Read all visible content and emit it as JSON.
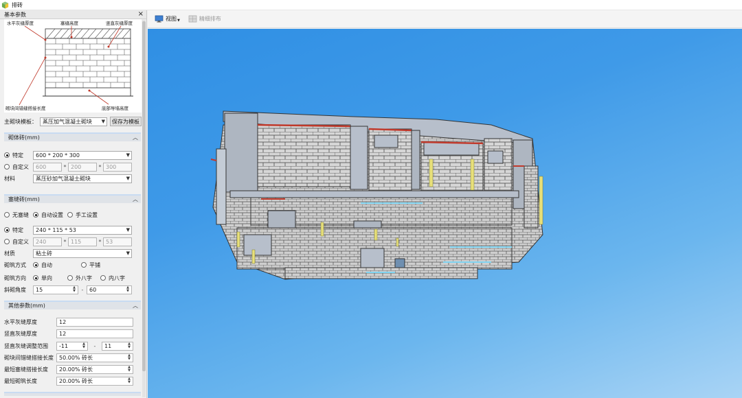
{
  "window": {
    "title": "排砖"
  },
  "panel": {
    "title": "基本参数"
  },
  "diagram": {
    "label_horizontal_joint": "水平灰缝厚度",
    "label_top_brick_height": "塞缝高度",
    "label_vertical_joint": "竖直灰缝厚度",
    "label_min_overlap": "砌块间错缝搭接长度",
    "label_bottom_height": "底部导墙高度"
  },
  "main_block": {
    "label": "主砌块模板：",
    "value": "蒸压加气混凝土砌块",
    "save_button": "保存为模板"
  },
  "block_section": {
    "title": "砌体砖(mm)",
    "specific_label": "特定",
    "specific_value": "600 * 200 * 300",
    "custom_label": "自定义",
    "custom_values": [
      "600",
      "200",
      "300"
    ],
    "sep": "*",
    "material_label": "材料",
    "material_value": "蒸压砂加气混凝土砌块"
  },
  "plug_section": {
    "title": "塞缝砖(mm)",
    "modes": [
      "无塞缝",
      "自动设置",
      "手工设置"
    ],
    "specific_label": "特定",
    "specific_value": "240 * 115 * 53",
    "custom_label": "自定义",
    "custom_values": [
      "240",
      "115",
      "53"
    ],
    "sep": "*",
    "material_label": "材质",
    "material_value": "粘土砖",
    "method_label": "砌筑方式",
    "methods": [
      "自动",
      "平铺"
    ],
    "direction_label": "砌筑方向",
    "directions": [
      "单向",
      "外八字",
      "内八字"
    ],
    "angle_label": "斜砌角度",
    "angle_from": "15",
    "angle_to": "60",
    "dash": "-"
  },
  "other_section": {
    "title": "其他参数(mm)",
    "horizontal_joint_label": "水平灰缝厚度",
    "horizontal_joint_value": "12",
    "vertical_joint_label": "竖直灰缝厚度",
    "vertical_joint_value": "12",
    "vertical_range_label": "竖直灰缝调整范围",
    "vertical_range_from": "-11",
    "vertical_range_to": "11",
    "dash": "-",
    "overlap_label": "砌块间错缝搭接长度",
    "overlap_value": "50.00% 砖长",
    "min_plug_overlap_label": "最短塞缝搭接长度",
    "min_plug_overlap_value": "20.00% 砖长",
    "min_block_label": "最短砌筑长度",
    "min_block_value": "20.00% 砖长"
  },
  "toolbar": {
    "view_label": "视图",
    "refine_label": "精细排布"
  },
  "colors": {
    "viewport_top": "#2f8fe4",
    "viewport_bottom": "#a9d4f5",
    "section_header": "#dfe3e8",
    "joint_red": "#c0392b",
    "brick_face": "#d6d6d6",
    "wall_face": "#b7bfcb",
    "yellow_element": "#e8e07a"
  }
}
